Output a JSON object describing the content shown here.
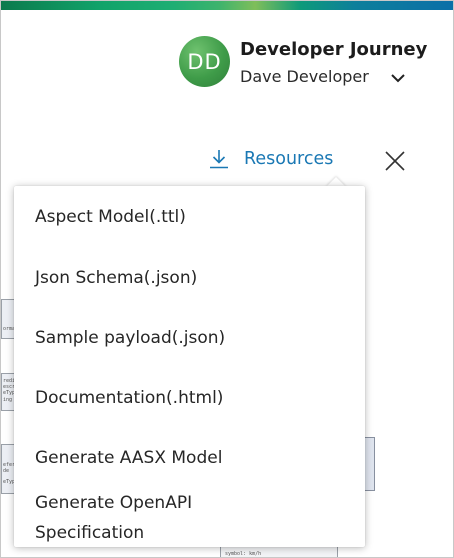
{
  "header": {
    "avatar_initials": "DD",
    "app_title": "Developer Journey",
    "user_name": "Dave Developer",
    "user_menu_icon": "chevron-down-icon"
  },
  "toolbar": {
    "resources_label": "Resources",
    "resources_icon": "download-icon",
    "close_icon": "close-icon"
  },
  "resources_menu": {
    "items": [
      {
        "label": "Aspect Model(.ttl)"
      },
      {
        "label": "Json Schema(.json)"
      },
      {
        "label": "Sample payload(.json)"
      },
      {
        "label": "Documentation(.html)"
      },
      {
        "label": "Generate AASX Model"
      },
      {
        "label": "Generate OpenAPI Specification"
      }
    ]
  },
  "background_diagram": {
    "fragment_1": "ormat",
    "fragment_2_lines": [
      "redit",
      "escri",
      "eType",
      "ing"
    ],
    "fragment_3_lines": [
      "efere",
      "de",
      "eType"
    ],
    "fragment_4": "symbol: km/h"
  },
  "colors": {
    "accent": "#1a78b4",
    "avatar": "#3f9c49",
    "brand_strip_start": "#0c7a4d",
    "brand_strip_end": "#0b6fa8"
  }
}
